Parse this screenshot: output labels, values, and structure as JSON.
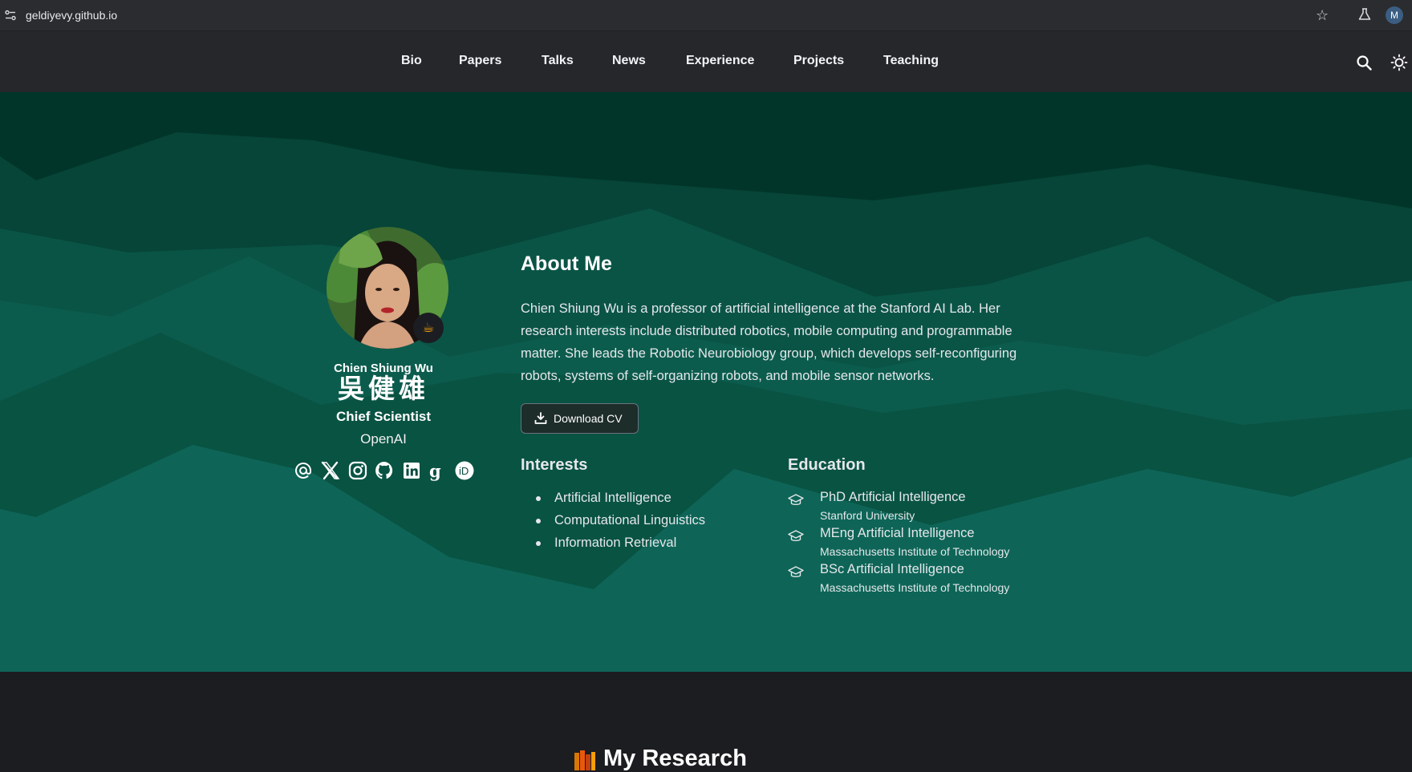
{
  "browser": {
    "url": "geldiyevy.github.io",
    "profile_initial": "M",
    "icons": [
      "site-settings-icon",
      "star-icon",
      "labs-flask-icon"
    ]
  },
  "nav": {
    "items": [
      "Bio",
      "Papers",
      "Talks",
      "News",
      "Experience",
      "Projects",
      "Teaching"
    ],
    "icons": [
      "search-icon",
      "theme-toggle-sun-icon"
    ]
  },
  "profile": {
    "name": "Chien Shiung Wu",
    "name_native": "吳健雄",
    "role": "Chief Scientist",
    "organization": "OpenAI",
    "status_emoji": "☕",
    "social_icons": [
      "email-icon",
      "x-twitter-icon",
      "instagram-icon",
      "github-icon",
      "linkedin-icon",
      "google-scholar-icon",
      "orcid-icon"
    ]
  },
  "about": {
    "title": "About Me",
    "text": "Chien Shiung Wu is a professor of artificial intelligence at the Stanford AI Lab. Her research interests include distributed robotics, mobile computing and programmable matter. She leads the Robotic Neurobiology group, which develops self-reconfiguring robots, systems of self-organizing robots, and mobile sensor networks.",
    "cv_button": "Download CV"
  },
  "interests": {
    "title": "Interests",
    "items": [
      "Artificial Intelligence",
      "Computational Linguistics",
      "Information Retrieval"
    ]
  },
  "education": {
    "title": "Education",
    "items": [
      {
        "degree": "PhD Artificial Intelligence",
        "institution": "Stanford University"
      },
      {
        "degree": "MEng Artificial Intelligence",
        "institution": "Massachusetts Institute of Technology"
      },
      {
        "degree": "BSc Artificial Intelligence",
        "institution": "Massachusetts Institute of Technology"
      }
    ]
  },
  "research": {
    "title": "My Research"
  },
  "colors": {
    "hero_dark": "#023529",
    "hero_mid": "#0b4a3f",
    "hero_light": "#0f6b5c",
    "page_dark": "#1c1d21",
    "navbar": "#26272b"
  }
}
